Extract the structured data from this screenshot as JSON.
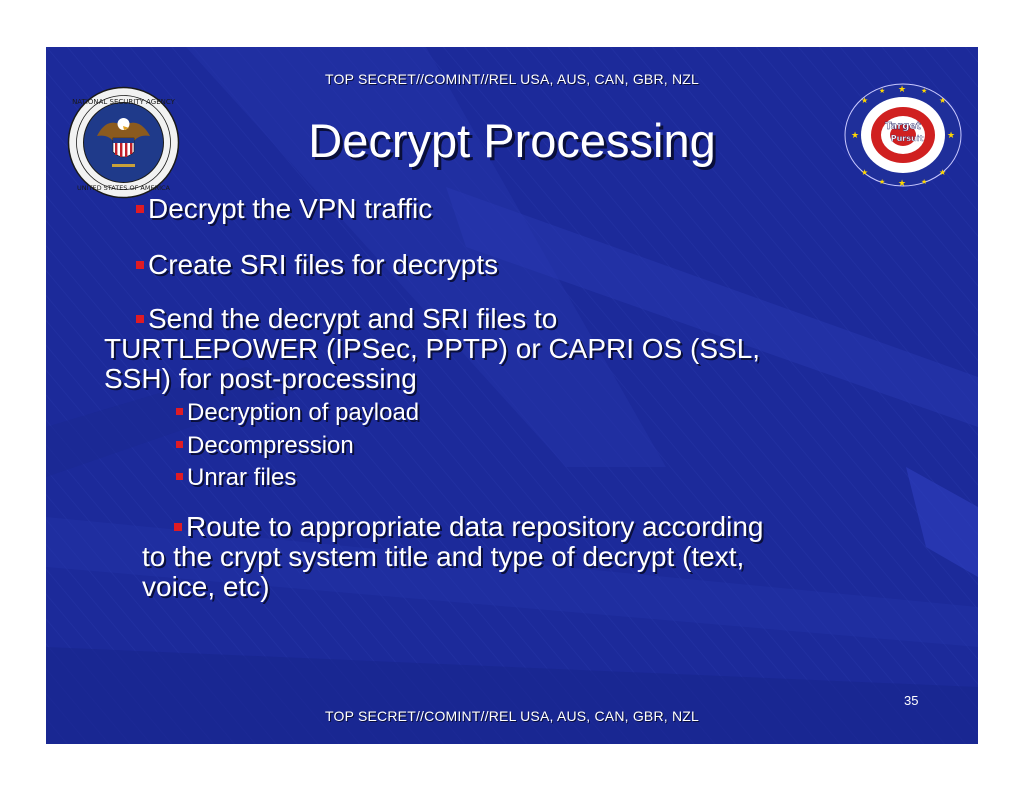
{
  "classification_top": "TOP SECRET//COMINT//REL USA, AUS, CAN, GBR, NZL",
  "classification_bottom": "TOP SECRET//COMINT//REL USA, AUS, CAN, GBR, NZL",
  "title": "Decrypt Processing",
  "page_number": "35",
  "bullets": {
    "b1": "Decrypt the VPN traffic",
    "b2": "Create SRI files for decrypts",
    "b3_line1": "Send the decrypt and SRI files to",
    "b3_line2": "TURTLEPOWER (IPSec, PPTP) or CAPRI OS (SSL,",
    "b3_line3": "SSH) for post-processing",
    "sub1": "Decryption of payload",
    "sub2": "Decompression",
    "sub3": "Unrar files",
    "b4_line1": "Route to appropriate data repository according",
    "b4_line2": "to the crypt system title and type of decrypt (text,",
    "b4_line3": "voice, etc)"
  },
  "logos": {
    "left": {
      "icon": "nsa-seal-icon",
      "text": "NATIONAL SECURITY AGENCY · UNITED STATES OF AMERICA"
    },
    "right": {
      "icon": "target-pursuit-logo-icon",
      "text_line1": "Target",
      "text_line2": "Pursuit"
    }
  },
  "colors": {
    "background": "#1c2a9a",
    "bullet": "#e01b24",
    "text": "#ffffff"
  }
}
